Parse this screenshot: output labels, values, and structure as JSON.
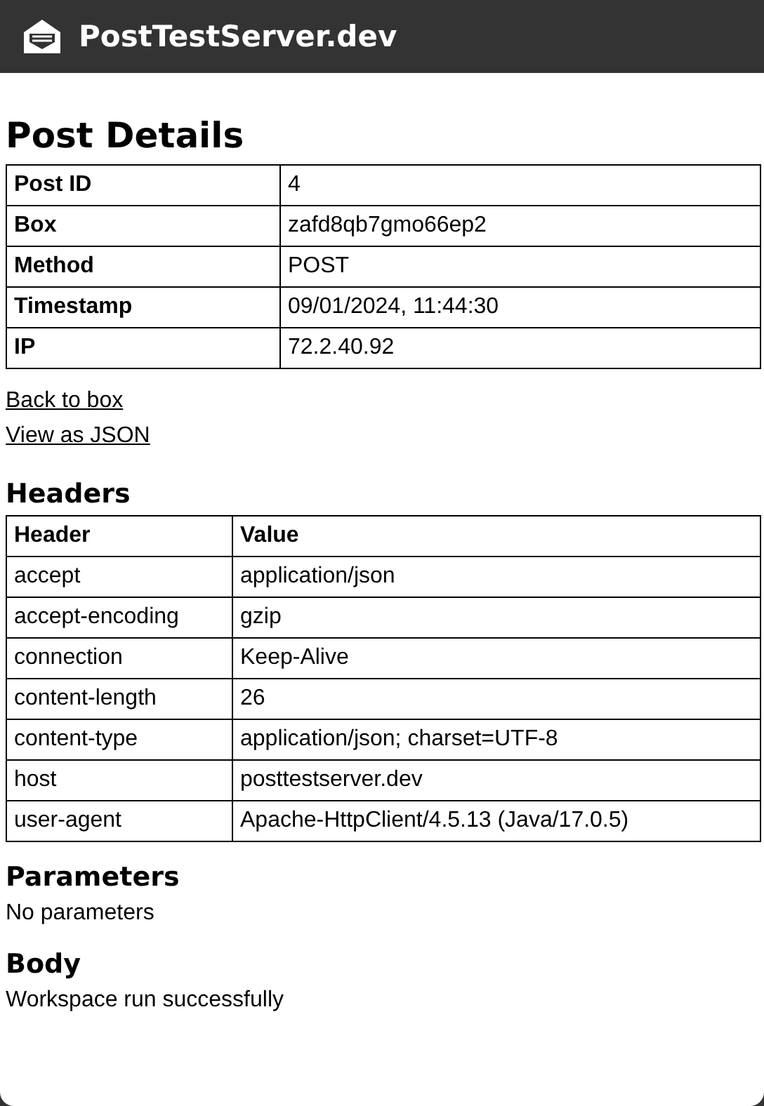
{
  "header": {
    "title": "PostTestServer.dev"
  },
  "post_details": {
    "heading": "Post Details",
    "rows": [
      {
        "label": "Post ID",
        "value": "4"
      },
      {
        "label": "Box",
        "value": "zafd8qb7gmo66ep2"
      },
      {
        "label": "Method",
        "value": "POST"
      },
      {
        "label": "Timestamp",
        "value": "09/01/2024, 11:44:30"
      },
      {
        "label": "IP",
        "value": "72.2.40.92"
      }
    ]
  },
  "links": [
    "Back to box",
    "View as JSON"
  ],
  "headers": {
    "heading": "Headers",
    "columns": [
      "Header",
      "Value"
    ],
    "rows": [
      [
        "accept",
        "application/json"
      ],
      [
        "accept-encoding",
        "gzip"
      ],
      [
        "connection",
        "Keep-Alive"
      ],
      [
        "content-length",
        "26"
      ],
      [
        "content-type",
        "application/json; charset=UTF-8"
      ],
      [
        "host",
        "posttestserver.dev"
      ],
      [
        "user-agent",
        "Apache-HttpClient/4.5.13 (Java/17.0.5)"
      ]
    ]
  },
  "parameters": {
    "heading": "Parameters",
    "text": "No parameters"
  },
  "body": {
    "heading": "Body",
    "text": "Workspace run successfully"
  }
}
